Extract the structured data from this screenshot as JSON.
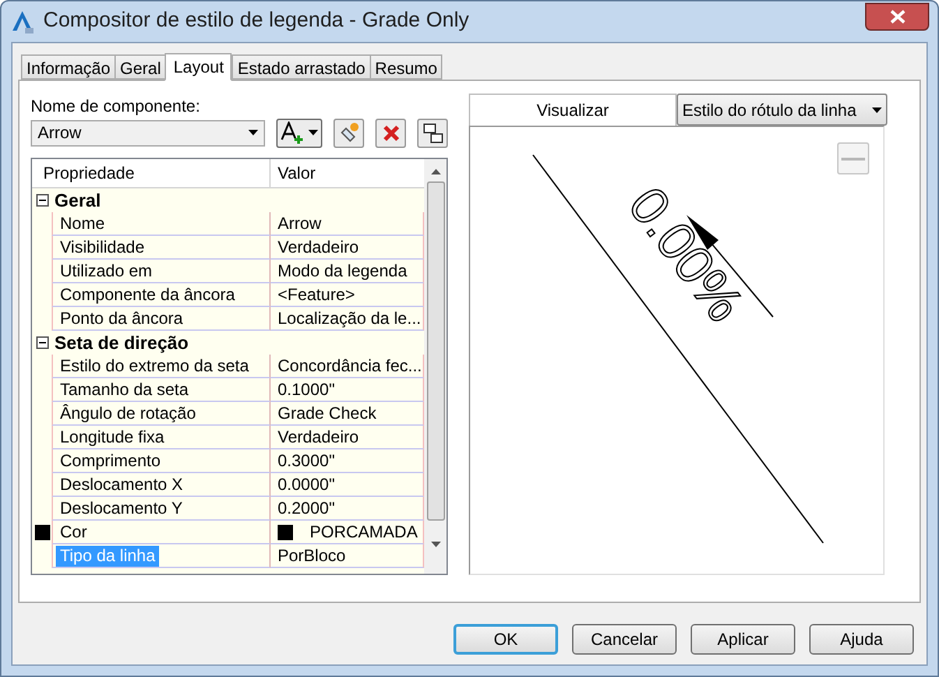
{
  "window": {
    "title": "Compositor de estilo de legenda - Grade Only"
  },
  "tabs": [
    {
      "label": "Informação",
      "selected": false
    },
    {
      "label": "Geral",
      "selected": false
    },
    {
      "label": "Layout",
      "selected": true
    },
    {
      "label": "Estado arrastado",
      "selected": false
    },
    {
      "label": "Resumo",
      "selected": false
    }
  ],
  "component": {
    "label": "Nome de componente:",
    "value": "Arrow"
  },
  "grid": {
    "columns": [
      "Propriedade",
      "Valor"
    ],
    "groups": [
      {
        "label": "Geral",
        "expanded": true,
        "rows": [
          {
            "kind": "text",
            "name": "Nome",
            "value": "Arrow",
            "selected": false
          },
          {
            "kind": "text",
            "name": "Visibilidade",
            "value": "Verdadeiro",
            "selected": false
          },
          {
            "kind": "text",
            "name": "Utilizado em",
            "value": "Modo da legenda",
            "selected": false
          },
          {
            "kind": "text",
            "name": "Componente da âncora",
            "value": "<Feature>",
            "selected": false
          },
          {
            "kind": "text",
            "name": "Ponto da âncora",
            "value": "Localização da le...",
            "selected": false
          }
        ]
      },
      {
        "label": "Seta de direção",
        "expanded": true,
        "rows": [
          {
            "kind": "text",
            "name": "Estilo do extremo da seta",
            "value": "Concordância fec...",
            "selected": false
          },
          {
            "kind": "text",
            "name": "Tamanho da seta",
            "value": "0.1000\"",
            "selected": false
          },
          {
            "kind": "text",
            "name": "Ângulo de rotação",
            "value": "Grade Check",
            "selected": false
          },
          {
            "kind": "text",
            "name": "Longitude fixa",
            "value": "Verdadeiro",
            "selected": false
          },
          {
            "kind": "text",
            "name": "Comprimento",
            "value": "0.3000\"",
            "selected": false
          },
          {
            "kind": "text",
            "name": "Deslocamento X",
            "value": "0.0000\"",
            "selected": false
          },
          {
            "kind": "text",
            "name": "Deslocamento Y",
            "value": "0.2000\"",
            "selected": false
          },
          {
            "kind": "color",
            "name": "Cor",
            "value": "PORCAMADA",
            "selected": false
          },
          {
            "kind": "text",
            "name": "Tipo da linha",
            "value": "PorBloco",
            "selected": true
          }
        ]
      }
    ]
  },
  "preview": {
    "label": "Visualizar",
    "style": "Estilo do rótulo da linha",
    "sample_text": "0.00%"
  },
  "buttons": [
    {
      "label": "OK",
      "default": true
    },
    {
      "label": "Cancelar",
      "default": false
    },
    {
      "label": "Aplicar",
      "default": false
    },
    {
      "label": "Ajuda",
      "default": false
    }
  ]
}
